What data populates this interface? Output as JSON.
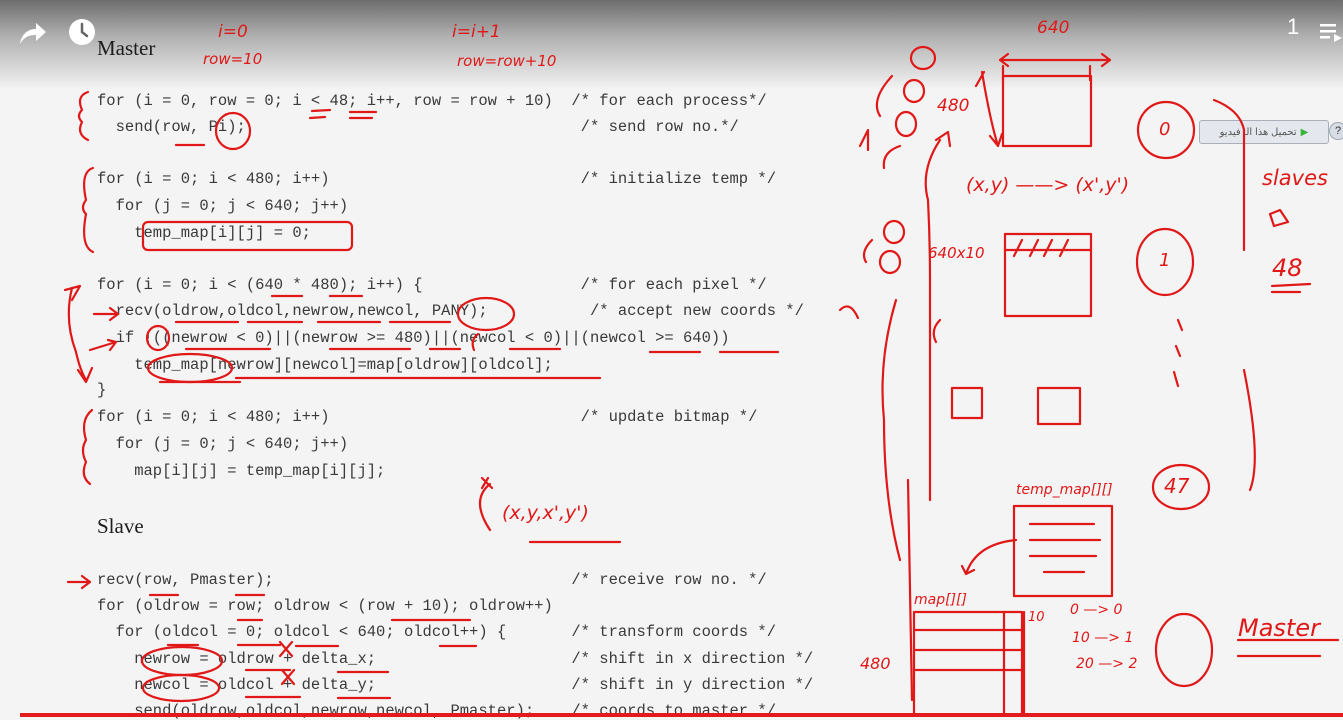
{
  "overlay": {
    "playlist_position": "1",
    "icons": [
      "share-icon",
      "watch-later-icon",
      "playlist-icon"
    ],
    "progress_fraction": 1.0
  },
  "download_button": {
    "label": "تحميل هذا الـ فيديو",
    "help": "?"
  },
  "master": {
    "heading": "Master",
    "lines": [
      "for (i = 0, row = 0; i < 48; i++, row = row + 10)  /* for each process*/",
      "  send(row, Pi);                                    /* send row no.*/",
      "for (i = 0; i < 480; i++)                           /* initialize temp */",
      "  for (j = 0; j < 640; j++)",
      "    temp_map[i][j] = 0;",
      "for (i = 0; i < (640 * 480); i++) {                 /* for each pixel */",
      "  recv(oldrow,oldcol,newrow,newcol, PANY);           /* accept new coords */",
      "  if !((newrow < 0)||(newrow >= 480)||(newcol < 0)||(newcol >= 640))",
      "    temp_map[newrow][newcol]=map[oldrow][oldcol];",
      "}",
      "for (i = 0; i < 480; i++)                           /* update bitmap */",
      "  for (j = 0; j < 640; j++)",
      "    map[i][j] = temp_map[i][j];"
    ]
  },
  "slave": {
    "heading": "Slave",
    "lines": [
      "recv(row, Pmaster);                                /* receive row no. */",
      "for (oldrow = row; oldrow < (row + 10); oldrow++)",
      "  for (oldcol = 0; oldcol < 640; oldcol++) {       /* transform coords */",
      "    newrow = oldrow + delta_x;                     /* shift in x direction */",
      "    newcol = oldcol + delta_y;                     /* shift in y direction */",
      "    send(oldrow,oldcol,newrow,newcol, Pmaster);    /* coords to master */"
    ]
  },
  "annotations": {
    "i_init": "i=0",
    "row_init": "row=10",
    "i_inc": "i=i+1",
    "row_inc": "row=row+10",
    "width": "640",
    "height": "480",
    "mapping": "(x,y) ——> (x',y')",
    "block": "640x10",
    "tuple": "(x,y,x',y')",
    "slaves": "slaves",
    "count": "48",
    "p0": "0",
    "p1": "1",
    "p47": "47",
    "temp_map": "temp_map[][]",
    "map": "map[][]",
    "map_h": "480",
    "row_map": [
      "0 —> 0",
      "10 —> 1",
      "20 —> 2"
    ],
    "row_10": "10",
    "master": "Master"
  }
}
